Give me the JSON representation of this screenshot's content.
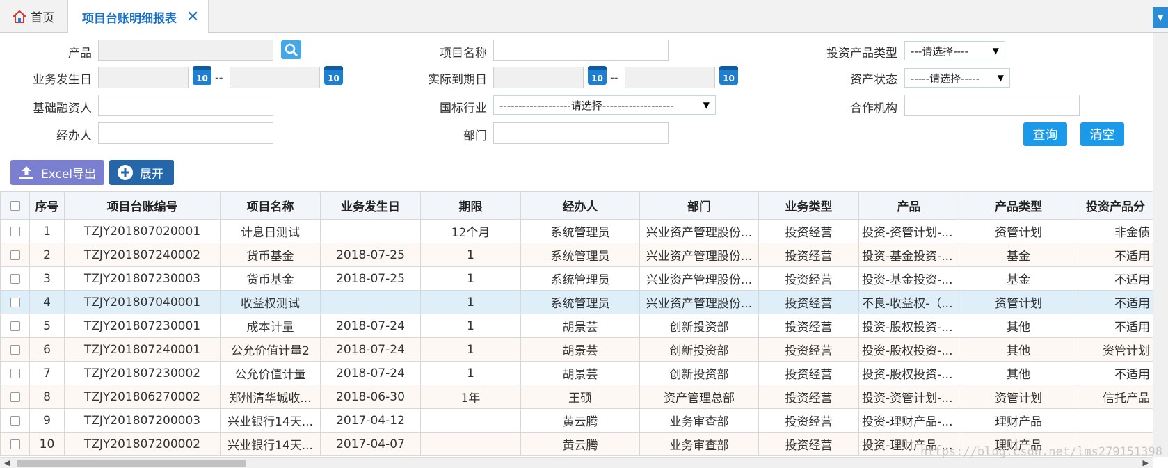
{
  "tabs": {
    "home_label": "首页",
    "active_label": "项目台账明细报表",
    "close_glyph": "✕",
    "dropdown_glyph": "▼"
  },
  "form": {
    "product_label": "产品",
    "project_name_label": "项目名称",
    "invest_type_label": "投资产品类型",
    "invest_type_value": "---请选择----",
    "biz_date_label": "业务发生日",
    "actual_due_label": "实际到期日",
    "asset_status_label": "资产状态",
    "asset_status_value": "-----请选择-----",
    "base_financier_label": "基础融资人",
    "industry_label": "国标行业",
    "industry_value": "-------------------请选择-------------------",
    "coop_org_label": "合作机构",
    "handler_label": "经办人",
    "dept_label": "部门",
    "date_sep": "--",
    "cal_text": "10",
    "query_label": "查询",
    "clear_label": "清空"
  },
  "toolbar": {
    "excel_label": "Excel导出",
    "expand_label": "展开"
  },
  "table": {
    "headers": [
      "序号",
      "项目台账编号",
      "项目名称",
      "业务发生日",
      "期限",
      "经办人",
      "部门",
      "业务类型",
      "产品",
      "产品类型",
      "投资产品分"
    ],
    "rows": [
      [
        "1",
        "TZJY201807020001",
        "计息日测试",
        "",
        "12个月",
        "系统管理员",
        "兴业资产管理股份...",
        "投资经营",
        "投资-资管计划-...",
        "资管计划",
        "非金债"
      ],
      [
        "2",
        "TZJY201807240002",
        "货币基金",
        "2018-07-25",
        "1",
        "系统管理员",
        "兴业资产管理股份...",
        "投资经营",
        "投资-基金投资-...",
        "基金",
        "不适用"
      ],
      [
        "3",
        "TZJY201807230003",
        "货币基金",
        "2018-07-25",
        "1",
        "系统管理员",
        "兴业资产管理股份...",
        "投资经营",
        "投资-基金投资-...",
        "基金",
        "不适用"
      ],
      [
        "4",
        "TZJY201807040001",
        "收益权测试",
        "",
        "1",
        "系统管理员",
        "兴业资产管理股份...",
        "投资经营",
        "不良-收益权-（...",
        "资管计划",
        "不适用"
      ],
      [
        "5",
        "TZJY201807230001",
        "成本计量",
        "2018-07-24",
        "1",
        "胡景芸",
        "创新投资部",
        "投资经营",
        "投资-股权投资-...",
        "其他",
        "不适用"
      ],
      [
        "6",
        "TZJY201807240001",
        "公允价值计量2",
        "2018-07-24",
        "1",
        "胡景芸",
        "创新投资部",
        "投资经营",
        "投资-股权投资-...",
        "其他",
        "资管计划"
      ],
      [
        "7",
        "TZJY201807230002",
        "公允价值计量",
        "2018-07-24",
        "1",
        "胡景芸",
        "创新投资部",
        "投资经营",
        "投资-股权投资-...",
        "其他",
        "不适用"
      ],
      [
        "8",
        "TZJY201806270002",
        "郑州清华城收...",
        "2018-06-30",
        "1年",
        "王硕",
        "资产管理总部",
        "投资经营",
        "投资-资管计划-...",
        "资管计划",
        "信托产品"
      ],
      [
        "9",
        "TZJY201807200003",
        "兴业银行14天...",
        "2017-04-12",
        "",
        "黄云腾",
        "业务审查部",
        "投资经营",
        "投资-理财产品-...",
        "理财产品",
        ""
      ],
      [
        "10",
        "TZJY201807200002",
        "兴业银行14天...",
        "2017-04-07",
        "",
        "黄云腾",
        "业务审查部",
        "投资经营",
        "投资-理财产品-...",
        "理财产品",
        ""
      ]
    ]
  },
  "watermark": "https://blog.csdn.net/lms279151398",
  "colors": {
    "accent": "#1a9ae8",
    "tab_active_text": "#1a6fc3",
    "selected_row": "#dfeffa"
  }
}
